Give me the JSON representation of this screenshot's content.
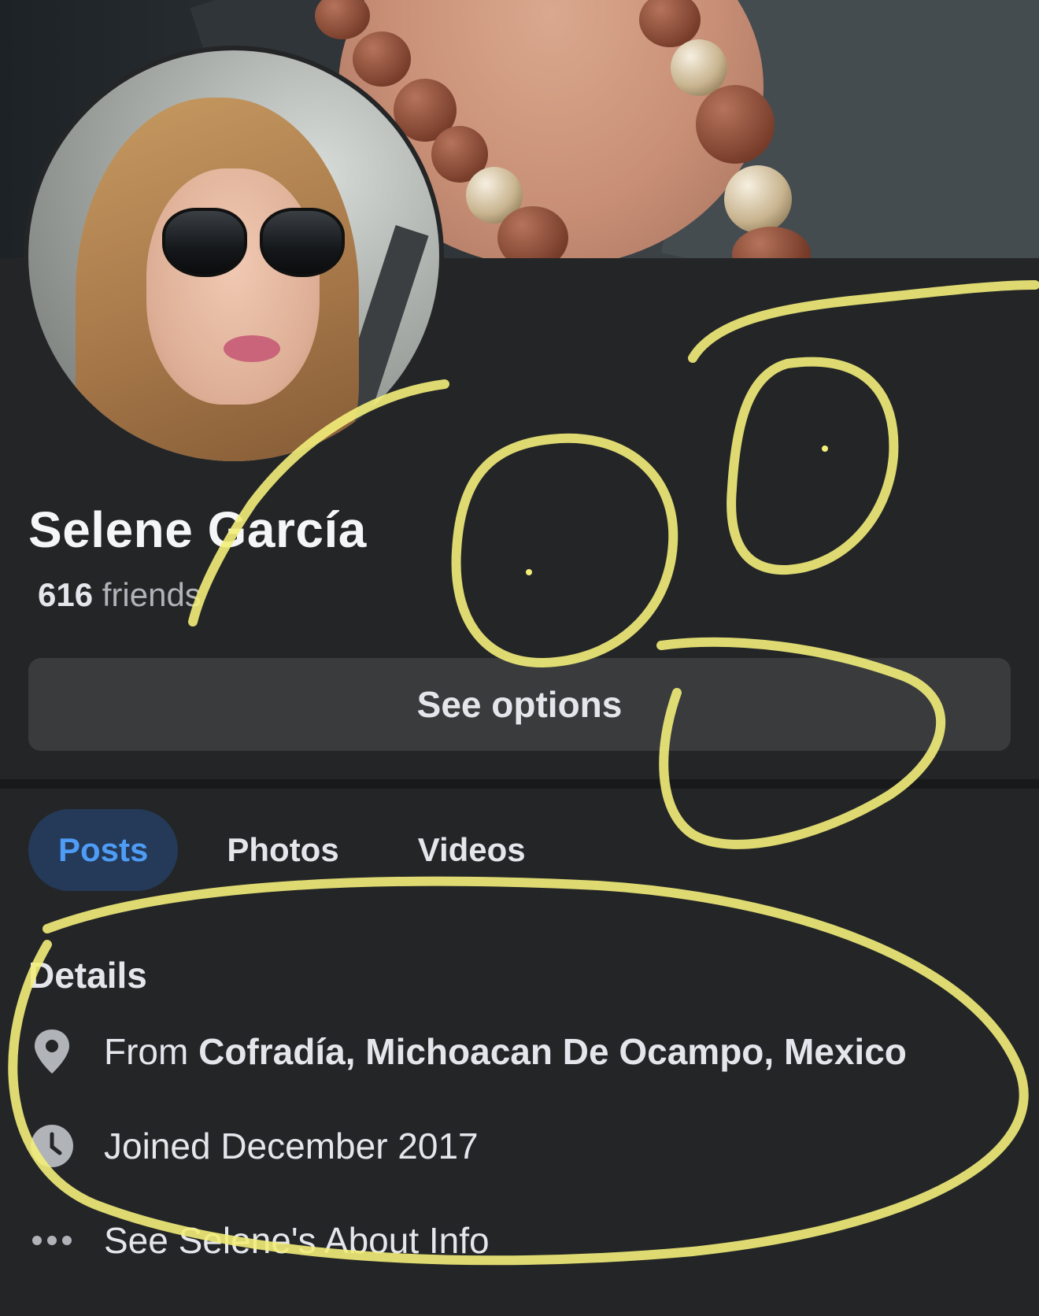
{
  "profile": {
    "name": "Selene García",
    "friends_count": "616",
    "friends_label": "friends"
  },
  "actions": {
    "see_options": "See options"
  },
  "tabs": [
    {
      "label": "Posts",
      "active": true
    },
    {
      "label": "Photos",
      "active": false
    },
    {
      "label": "Videos",
      "active": false
    }
  ],
  "details": {
    "title": "Details",
    "from_prefix": "From",
    "from_place": "Cofradía, Michoacan De Ocampo, Mexico",
    "joined": "Joined December 2017",
    "about_link": "See Selene's About Info"
  },
  "icons": {
    "location": "location-pin-icon",
    "clock": "clock-icon",
    "more": "more-dots-icon"
  },
  "colors": {
    "background": "#242527",
    "active_tab_bg": "#243a58",
    "active_tab_text": "#4e9cf5",
    "button_bg": "#3a3b3d",
    "annotation": "#f3ee7a"
  }
}
